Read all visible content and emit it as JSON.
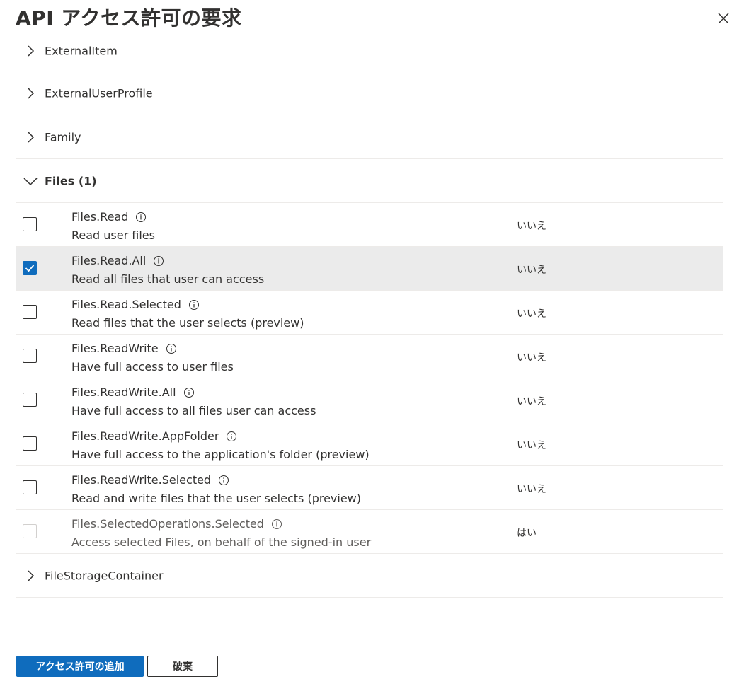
{
  "panel": {
    "title": "API アクセス許可の要求",
    "close_icon": "close-icon"
  },
  "groups_before": [
    {
      "label": "ExternalItem",
      "expanded": false
    },
    {
      "label": "ExternalUserProfile",
      "expanded": false
    },
    {
      "label": "Family",
      "expanded": false
    }
  ],
  "files_group": {
    "label": "Files (1)",
    "expanded": true,
    "permissions": [
      {
        "name": "Files.Read",
        "description": "Read user files",
        "admin_consent": "いいえ",
        "checked": false,
        "disabled": false
      },
      {
        "name": "Files.Read.All",
        "description": "Read all files that user can access",
        "admin_consent": "いいえ",
        "checked": true,
        "disabled": false
      },
      {
        "name": "Files.Read.Selected",
        "description": "Read files that the user selects (preview)",
        "admin_consent": "いいえ",
        "checked": false,
        "disabled": false
      },
      {
        "name": "Files.ReadWrite",
        "description": "Have full access to user files",
        "admin_consent": "いいえ",
        "checked": false,
        "disabled": false
      },
      {
        "name": "Files.ReadWrite.All",
        "description": "Have full access to all files user can access",
        "admin_consent": "いいえ",
        "checked": false,
        "disabled": false
      },
      {
        "name": "Files.ReadWrite.AppFolder",
        "description": "Have full access to the application's folder (preview)",
        "admin_consent": "いいえ",
        "checked": false,
        "disabled": false
      },
      {
        "name": "Files.ReadWrite.Selected",
        "description": "Read and write files that the user selects (preview)",
        "admin_consent": "いいえ",
        "checked": false,
        "disabled": false
      },
      {
        "name": "Files.SelectedOperations.Selected",
        "description": "Access selected Files, on behalf of the signed-in user",
        "admin_consent": "はい",
        "checked": false,
        "disabled": true
      }
    ]
  },
  "groups_after": [
    {
      "label": "FileStorageContainer",
      "expanded": false
    }
  ],
  "footer": {
    "add_button": "アクセス許可の追加",
    "discard_button": "破棄"
  },
  "colors": {
    "accent": "#0f6cbd",
    "selected_row": "#ebebeb",
    "divider": "#edebe9",
    "text": "#323130"
  }
}
